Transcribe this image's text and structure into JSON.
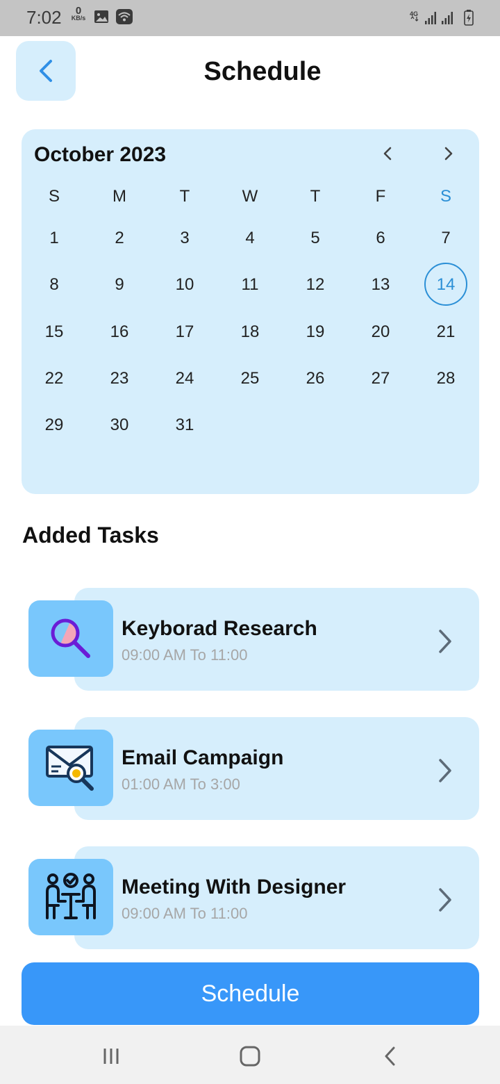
{
  "status_bar": {
    "time": "7:02",
    "net_speed_value": "0",
    "net_speed_unit": "KB/s",
    "network_label": "4G"
  },
  "header": {
    "title": "Schedule"
  },
  "calendar": {
    "month_label": "October 2023",
    "weekdays": [
      "S",
      "M",
      "T",
      "W",
      "T",
      "F",
      "S"
    ],
    "days": [
      "1",
      "2",
      "3",
      "4",
      "5",
      "6",
      "7",
      "8",
      "9",
      "10",
      "11",
      "12",
      "13",
      "14",
      "15",
      "16",
      "17",
      "18",
      "19",
      "20",
      "21",
      "22",
      "23",
      "24",
      "25",
      "26",
      "27",
      "28",
      "29",
      "30",
      "31"
    ],
    "selected_day": "14",
    "accent_color": "#2b8fd6"
  },
  "tasks_section": {
    "title": "Added Tasks",
    "items": [
      {
        "title": "Keyborad Research",
        "time": "09:00 AM To 11:00",
        "icon": "search-icon"
      },
      {
        "title": "Email Campaign",
        "time": "01:00 AM To 3:00",
        "icon": "email-search-icon"
      },
      {
        "title": "Meeting With Designer",
        "time": "09:00 AM To 11:00",
        "icon": "meeting-icon"
      }
    ]
  },
  "actions": {
    "schedule_label": "Schedule",
    "button_color": "#3897f9"
  }
}
